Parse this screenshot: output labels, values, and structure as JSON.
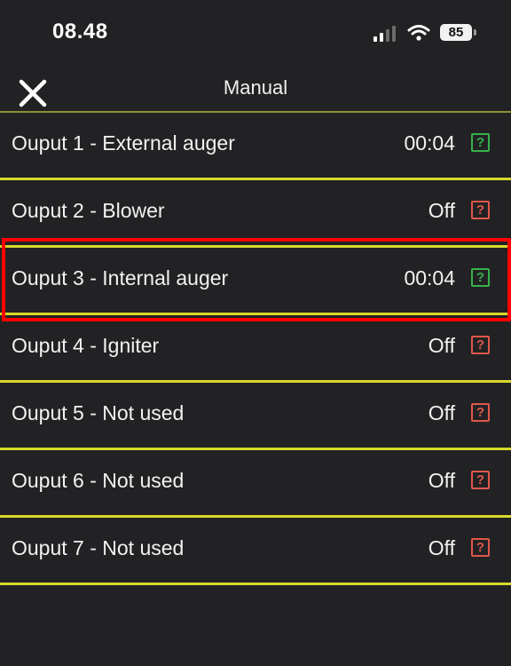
{
  "status_bar": {
    "time": "08.48",
    "battery": "85",
    "icons": [
      "signal-icon",
      "wifi-icon",
      "battery-icon"
    ]
  },
  "header": {
    "title": "Manual",
    "close_icon": "close-icon"
  },
  "outputs": [
    {
      "label": "Ouput 1 - External auger",
      "value": "00:04",
      "help": "?",
      "state": "on"
    },
    {
      "label": "Ouput 2 - Blower",
      "value": "Off",
      "help": "?",
      "state": "off"
    },
    {
      "label": "Ouput 3 - Internal auger",
      "value": "00:04",
      "help": "?",
      "state": "on",
      "highlighted": true
    },
    {
      "label": "Ouput 4 - Igniter",
      "value": "Off",
      "help": "?",
      "state": "off"
    },
    {
      "label": "Ouput 5 - Not used",
      "value": "Off",
      "help": "?",
      "state": "off"
    },
    {
      "label": "Ouput 6 - Not used",
      "value": "Off",
      "help": "?",
      "state": "off"
    },
    {
      "label": "Ouput 7 - Not used",
      "value": "Off",
      "help": "?",
      "state": "off"
    }
  ],
  "colors": {
    "background": "#222225",
    "divider": "#d9d92a",
    "active_help": "#36b24a",
    "inactive_help": "#e0584a",
    "highlight": "#ff0000"
  }
}
